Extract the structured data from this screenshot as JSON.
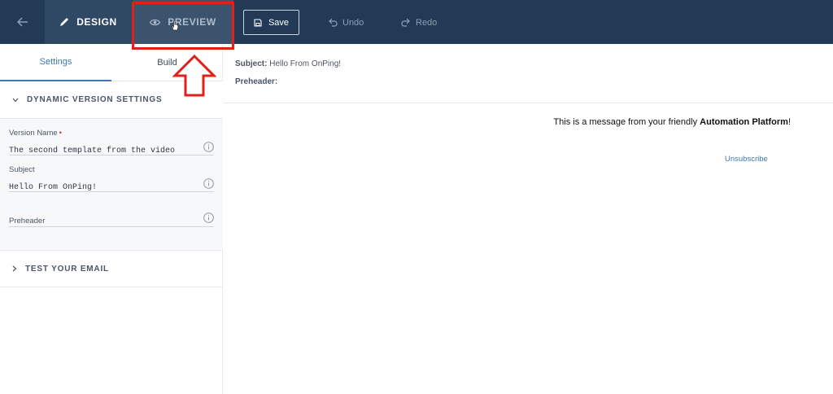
{
  "topbar": {
    "back_icon": "arrow-left-icon",
    "design_label": "DESIGN",
    "design_icon": "pencil-icon",
    "preview_label": "PREVIEW",
    "preview_icon": "eye-icon",
    "save_label": "Save",
    "save_icon": "floppy-disk-icon",
    "undo_label": "Undo",
    "undo_icon": "undo-icon",
    "redo_label": "Redo",
    "redo_icon": "redo-icon"
  },
  "sidebar": {
    "tabs": [
      {
        "label": "Settings",
        "active": true
      },
      {
        "label": "Build",
        "active": false
      }
    ],
    "dynamic_section": {
      "title": "DYNAMIC VERSION SETTINGS",
      "expanded": true,
      "fields": [
        {
          "label": "Version Name",
          "required": true,
          "value": "The second template from the video"
        },
        {
          "label": "Subject",
          "required": false,
          "value": "Hello From OnPing!"
        },
        {
          "label": "Preheader",
          "required": false,
          "value": ""
        }
      ]
    },
    "test_section": {
      "title": "TEST YOUR EMAIL",
      "expanded": false
    }
  },
  "preview": {
    "subject_label": "Subject:",
    "subject_value": "Hello From OnPing!",
    "preheader_label": "Preheader:",
    "message_prefix": "This is a message from your friendly ",
    "message_bold": "Automation Platform",
    "message_suffix": "!",
    "unsubscribe": "Unsubscribe"
  },
  "annotation": {
    "color": "#e0201b",
    "target": "PREVIEW"
  },
  "colors": {
    "topbar": "#223a55",
    "active_tab": "#3a78b8"
  }
}
